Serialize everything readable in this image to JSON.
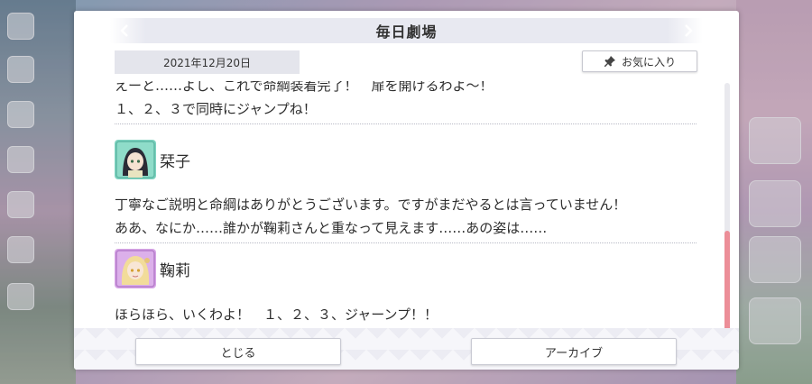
{
  "dialog": {
    "title": "毎日劇場",
    "date": "2021年12月20日",
    "favorite_label": "お気に入り"
  },
  "script": {
    "partial_line": "えーと……よし、これで命綱装着完了！　扉を開けるわよ～！",
    "line_1": "１、２、３で同時にジャンプね！",
    "speaker_2": "栞子",
    "speaker_2_line_1": "丁寧なご説明と命綱はありがとうございます。ですがまだやるとは言っていません！",
    "speaker_2_line_2": "ああ、なにか……誰かが鞠莉さんと重なって見えます……あの姿は……",
    "speaker_3": "鞠莉",
    "speaker_3_line_1": "ほらほら、いくわよ！　１、２、３、ジャーンプ！！"
  },
  "buttons": {
    "close_label": "とじる",
    "archive_label": "アーカイブ"
  },
  "colors": {
    "accent_scroll": "#ec8e98",
    "avatar_shioriko_bg": "#7fd3c0",
    "avatar_mari_bg": "#d7a6e6"
  },
  "icons": {
    "favorite": "pin-icon",
    "scroll": "scrollbar"
  }
}
